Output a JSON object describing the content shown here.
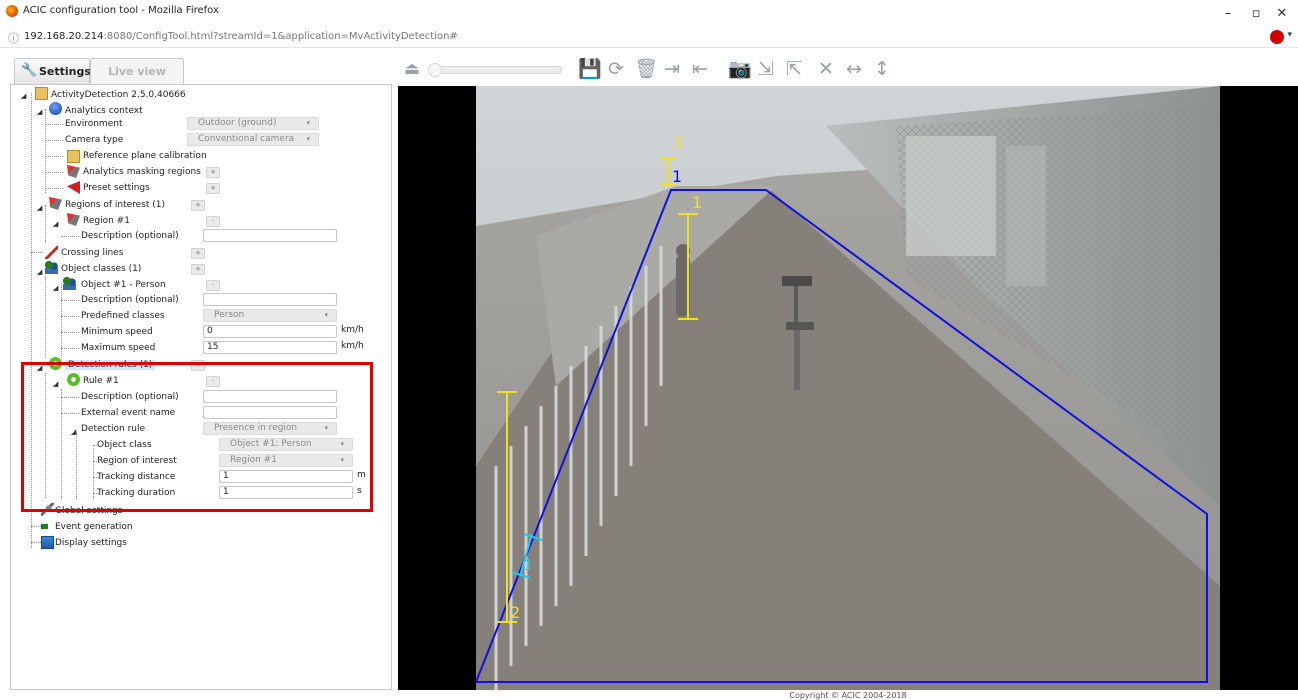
{
  "window": {
    "title": "ACIC configuration tool - Mozilla Firefox",
    "url_host": "192.168.20.214",
    "url_rest": ":8080/ConfigTool.html?streamId=1&application=MvActivityDetection#"
  },
  "tabs": {
    "settings": "Settings",
    "live_view": "Live view"
  },
  "tree": {
    "root": "ActivityDetection 2.5.0.40666",
    "analytics_context": "Analytics context",
    "environment_label": "Environment",
    "environment_value": "Outdoor (ground)",
    "camera_type_label": "Camera type",
    "camera_type_value": "Conventional camera",
    "reference_plane": "Reference plane calibration",
    "masking_regions": "Analytics masking regions",
    "preset_settings": "Preset settings",
    "regions_of_interest": "Regions of interest (1)",
    "region_1": "Region #1",
    "region_description_label": "Description (optional)",
    "crossing_lines": "Crossing lines",
    "object_classes": "Object classes (1)",
    "object_1": "Object #1 - Person",
    "object_description_label": "Description (optional)",
    "predefined_classes_label": "Predefined classes",
    "predefined_classes_value": "Person",
    "min_speed_label": "Minimum speed",
    "min_speed_value": "0",
    "max_speed_label": "Maximum speed",
    "max_speed_value": "15",
    "speed_unit": "km/h",
    "detection_rules": "Detection rules (1)",
    "rule_1": "Rule #1",
    "rule_description_label": "Description (optional)",
    "external_event_label": "External event name",
    "detection_rule_label": "Detection rule",
    "detection_rule_value": "Presence in region",
    "object_class_label": "Object class",
    "object_class_value": "Object #1: Person",
    "region_of_interest_label": "Region of interest",
    "region_of_interest_value": "Region #1",
    "tracking_distance_label": "Tracking distance",
    "tracking_distance_value": "1",
    "tracking_distance_unit": "m",
    "tracking_duration_label": "Tracking duration",
    "tracking_duration_value": "1",
    "tracking_duration_unit": "s",
    "global_settings": "Global settings",
    "event_generation": "Event generation",
    "display_settings": "Display settings",
    "add_symbol": "+",
    "remove_symbol": "-"
  },
  "overlay_labels": {
    "marker_1_top": "1",
    "marker_1_person": "1",
    "marker_2": "2",
    "marker_3": "3",
    "marker_cyan": "1"
  },
  "footer": {
    "copyright": "Copyright © ACIC 2004-2018"
  },
  "colors": {
    "highlight": "#e00000",
    "region_outline": "#1010e0",
    "calibration": "#f0e020",
    "cyan_marker": "#20c8f0"
  }
}
